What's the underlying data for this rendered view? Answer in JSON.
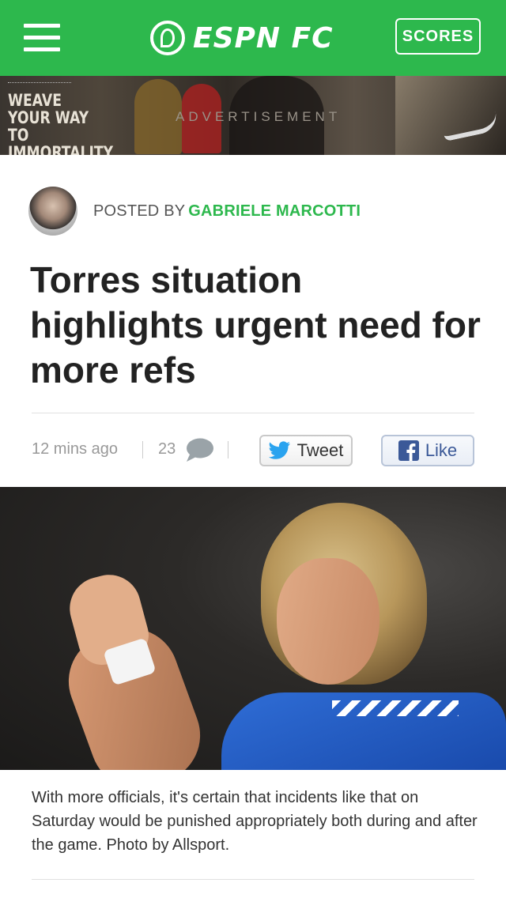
{
  "header": {
    "logo_text": "ESPN FC",
    "scores_label": "SCORES",
    "brand_color": "#2db84d"
  },
  "ad": {
    "headline": "WEAVE\nYOUR WAY\nTO IMMORTALITY",
    "label": "ADVERTISEMENT"
  },
  "article": {
    "posted_by": "POSTED BY",
    "author": "GABRIELE MARCOTTI",
    "title": "Torres situation highlights urgent need for more refs",
    "timestamp": "12 mins ago",
    "comment_count": "23",
    "tweet_label": "Tweet",
    "like_label": "Like",
    "caption": "With more officials, it's certain that incidents like that on Saturday would be punished appropriately both during and after the game. Photo by Allsport."
  },
  "icons": {
    "menu": "hamburger-icon",
    "comment": "speech-bubble-icon",
    "twitter": "twitter-bird-icon",
    "facebook": "facebook-icon"
  }
}
